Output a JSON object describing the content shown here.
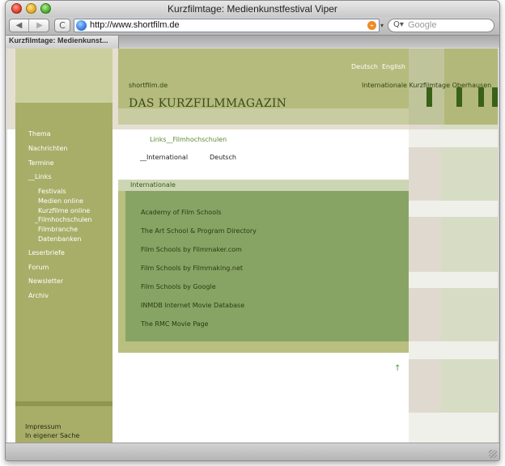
{
  "window": {
    "title": "Kurzfilmtage: Medienkunstfestival Viper"
  },
  "toolbar": {
    "back_label": "◀",
    "forward_label": "▶",
    "reload_label": "C",
    "url": "http://www.shortfilm.de",
    "search_placeholder": "Google"
  },
  "tab": {
    "label": "Kurzfilmtage: Medienkunst..."
  },
  "site": {
    "languages": [
      "Deutsch",
      "English"
    ],
    "brand_small": "shortfilm.de",
    "brand_right": "Internationale Kurzfilmtage Oberhausen",
    "brand_title": "DAS KURZFILMMAGAZIN",
    "breadcrumb": "Links__Filmhochschulen",
    "subtabs": [
      "__International",
      "Deutsch"
    ],
    "section_title": "Internationale",
    "links": [
      "Academy of Film Schools",
      "The Art School & Program Directory",
      "Film Schools by Filmmaker.com",
      "Film Schools by Filmmaking.net",
      "Film Schools by Google",
      "INMDB Internet Movie Database",
      "The RMC Movie Page"
    ],
    "up_arrow": "↑",
    "nav": {
      "thema": "Thema",
      "nachrichten": "Nachrichten",
      "termine": "Termine",
      "links": "__Links",
      "sub": [
        "Festivals",
        "Medien online",
        "Kurzfilme online",
        "_Filmhochschulen",
        "Filmbranche",
        "Datenbanken"
      ],
      "leserbriefe": "Leserbriefe",
      "forum": "Forum",
      "newsletter": "Newsletter",
      "archiv": "Archiv"
    },
    "footer": [
      "Impressum",
      "In eigener Sache"
    ]
  }
}
